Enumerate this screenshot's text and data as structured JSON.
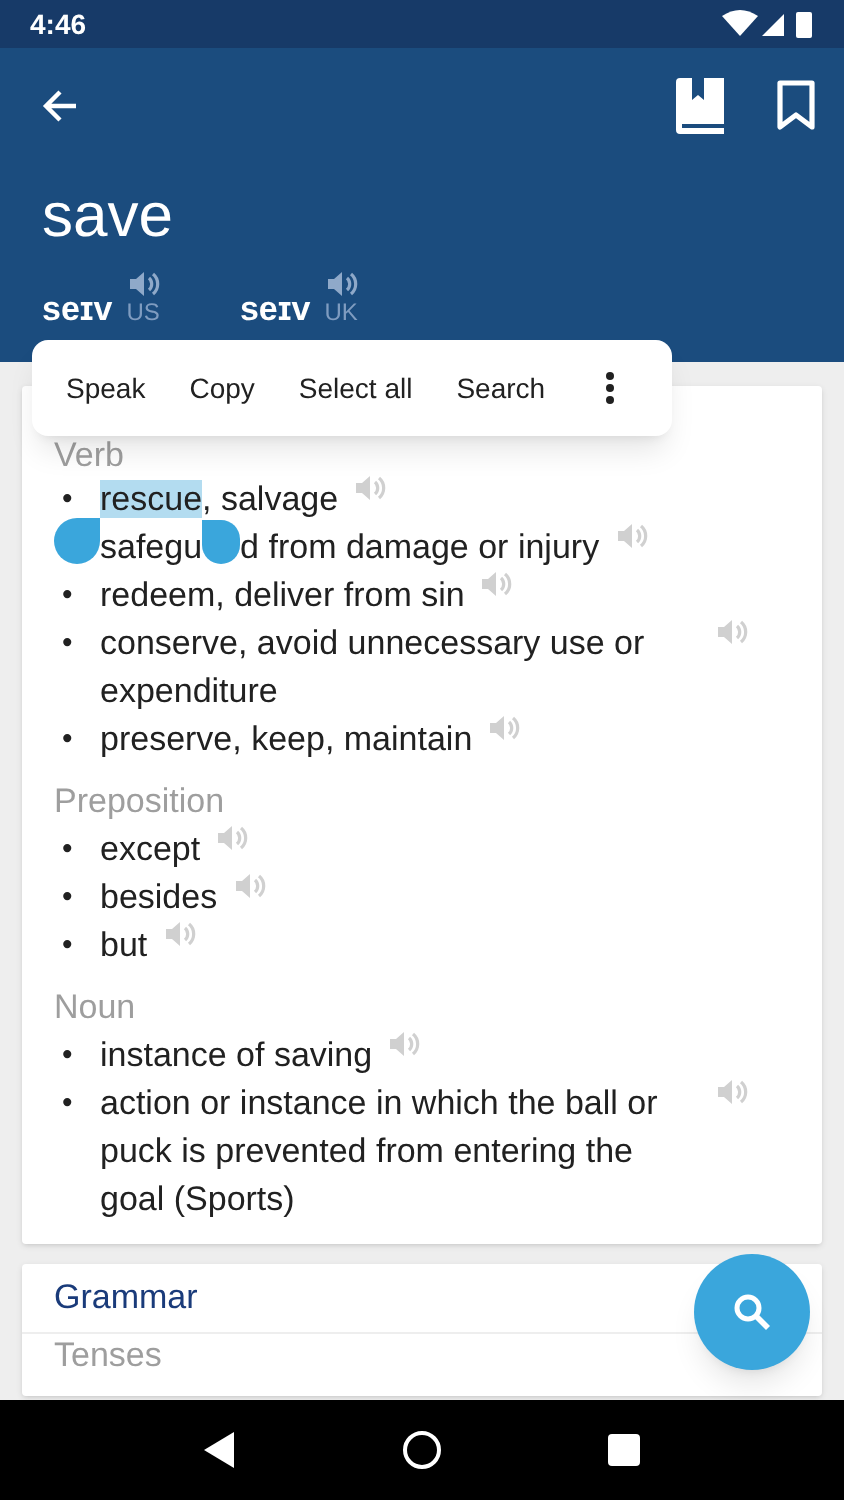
{
  "status_bar": {
    "time": "4:46"
  },
  "header": {
    "word": "save",
    "pronunciations": [
      {
        "phonetic": "seɪv",
        "region": "US"
      },
      {
        "phonetic": "seɪv",
        "region": "UK"
      }
    ]
  },
  "context_menu": {
    "items": [
      "Speak",
      "Copy",
      "Select all",
      "Search"
    ]
  },
  "definitions": [
    {
      "part_of_speech": "Verb",
      "senses": [
        {
          "bullet": "•",
          "parts": [
            {
              "text": "rescue",
              "selected": true
            },
            {
              "text": ", salvage",
              "selected": false
            }
          ]
        },
        {
          "handle": true,
          "parts": [
            {
              "text": "safegu",
              "selected": false
            },
            {
              "kind": "handle"
            },
            {
              "text": "d from damage or injury",
              "selected": false
            }
          ]
        },
        {
          "bullet": "•",
          "parts": [
            {
              "text": "redeem, deliver from sin",
              "selected": false
            }
          ]
        },
        {
          "bullet": "•",
          "parts": [
            {
              "text": "conserve, avoid unnecessary use or expenditure",
              "selected": false
            }
          ]
        },
        {
          "bullet": "•",
          "parts": [
            {
              "text": "preserve, keep, maintain",
              "selected": false
            }
          ]
        }
      ]
    },
    {
      "part_of_speech": "Preposition",
      "senses": [
        {
          "bullet": "•",
          "parts": [
            {
              "text": "except",
              "selected": false
            }
          ]
        },
        {
          "bullet": "•",
          "parts": [
            {
              "text": "besides",
              "selected": false
            }
          ]
        },
        {
          "bullet": "•",
          "parts": [
            {
              "text": "but",
              "selected": false
            }
          ]
        }
      ]
    },
    {
      "part_of_speech": "Noun",
      "senses": [
        {
          "bullet": "•",
          "parts": [
            {
              "text": "instance of saving",
              "selected": false
            }
          ]
        },
        {
          "bullet": "•",
          "parts": [
            {
              "text": "action or instance in which the ball or puck is prevented from entering the goal (Sports)",
              "selected": false
            }
          ]
        }
      ]
    }
  ],
  "grammar": {
    "title": "Grammar",
    "sections": [
      "Tenses"
    ]
  }
}
